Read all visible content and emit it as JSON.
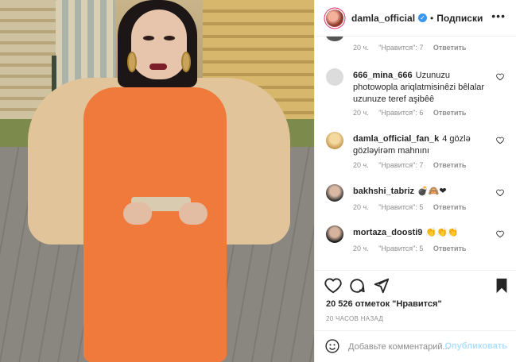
{
  "header": {
    "username": "damla_official",
    "separator": "•",
    "follow_label": "Подписки",
    "more_label": "•••"
  },
  "comments": [
    {
      "meta": {
        "time": "20 ч.",
        "likes": "\"Нравится\": 7",
        "reply": "Ответить"
      }
    },
    {
      "username": "666_mina_666",
      "text": "Uzunuzu photowopla ariqlatmisinêzi bêlalar uzunuze teref aşibêê",
      "meta": {
        "time": "20 ч.",
        "likes": "\"Нравится\": 6",
        "reply": "Ответить"
      }
    },
    {
      "username": "damla_official_fan_k",
      "text": "4 gözlə gözləyirəm mahnını",
      "meta": {
        "time": "20 ч.",
        "likes": "\"Нравится\": 7",
        "reply": "Ответить"
      }
    },
    {
      "username": "bakhshi_tabriz",
      "text": "💣🙈❤",
      "meta": {
        "time": "20 ч.",
        "likes": "\"Нравится\": 5",
        "reply": "Ответить"
      }
    },
    {
      "username": "mortaza_doosti9",
      "text": "👏👏👏",
      "meta": {
        "time": "20 ч.",
        "likes": "\"Нравится\": 5",
        "reply": "Ответить"
      }
    }
  ],
  "likes_text": "20 526 отметок \"Нравится\"",
  "timestamp": "20 ЧАСОВ НАЗАД",
  "add_comment": {
    "placeholder": "Добавьте комментарий...",
    "post_label": "Опубликовать"
  },
  "icons": {
    "like": "heart-icon",
    "comment": "comment-icon",
    "share": "share-icon",
    "save": "bookmark-icon",
    "emoji": "emoji-icon",
    "verified": "verified-badge-icon"
  },
  "colors": {
    "verified": "#3897f0",
    "post_button_disabled": "#b2dffc",
    "meta_text": "#8e8e8e"
  }
}
